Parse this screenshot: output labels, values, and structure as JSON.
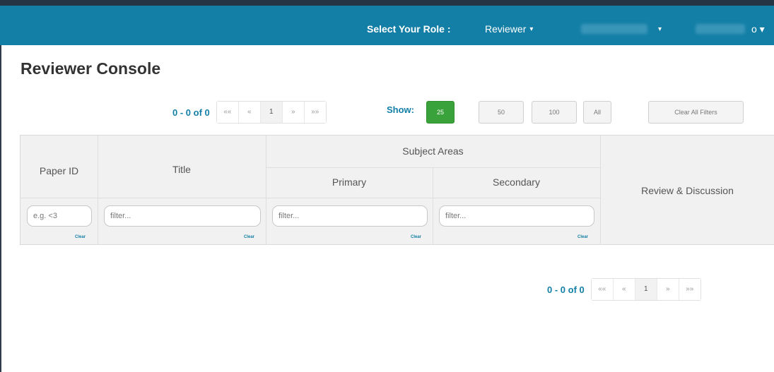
{
  "navbar": {
    "role_label": "Select Your Role :",
    "role_value": "Reviewer",
    "caret": "▾",
    "user_caret": "o ▾"
  },
  "page": {
    "title": "Reviewer Console"
  },
  "pager_top": {
    "count": "0 - 0 of 0",
    "first": "««",
    "prev": "«",
    "page": "1",
    "next": "»",
    "last": "»»"
  },
  "pager_bottom": {
    "count": "0 - 0 of 0",
    "first": "««",
    "prev": "«",
    "page": "1",
    "next": "»",
    "last": "»»"
  },
  "show": {
    "label": "Show:",
    "options": [
      "25",
      "50",
      "100",
      "All"
    ],
    "selected": "25"
  },
  "clear_all_filters": "Clear All Filters",
  "table": {
    "headers": {
      "paper_id": "Paper ID",
      "title": "Title",
      "subject_areas": "Subject Areas",
      "primary": "Primary",
      "secondary": "Secondary",
      "review": "Review & Discussion"
    },
    "filters": {
      "paper_id_placeholder": "e.g. <3",
      "title_placeholder": "filter...",
      "primary_placeholder": "filter...",
      "secondary_placeholder": "filter...",
      "clear_label": "Clear"
    }
  }
}
